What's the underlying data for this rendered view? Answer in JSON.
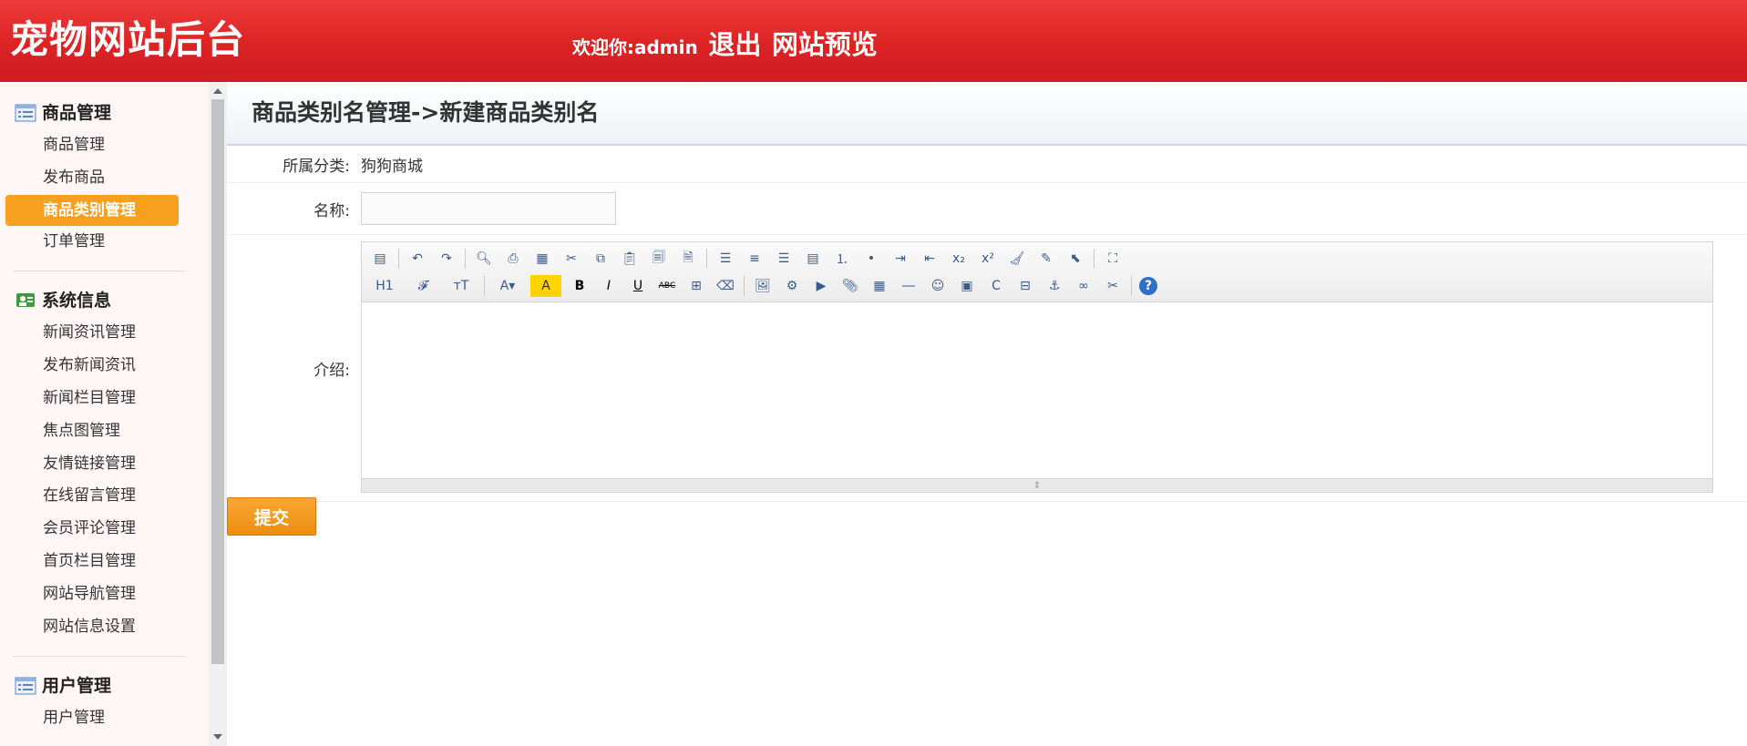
{
  "header": {
    "brand": "宠物网站后台",
    "welcome": "欢迎你:admin",
    "logout": "退出",
    "preview": "网站预览"
  },
  "sidebar": {
    "groups": [
      {
        "title": "商品管理",
        "icon": "list-icon",
        "items": [
          "商品管理",
          "发布商品",
          "商品类别管理",
          "订单管理"
        ],
        "active_index": 2
      },
      {
        "title": "系统信息",
        "icon": "users-icon",
        "items": [
          "新闻资讯管理",
          "发布新闻资讯",
          "新闻栏目管理",
          "焦点图管理",
          "友情链接管理",
          "在线留言管理",
          "会员评论管理",
          "首页栏目管理",
          "网站导航管理",
          "网站信息设置"
        ]
      },
      {
        "title": "用户管理",
        "icon": "list-icon",
        "items": [
          "用户管理"
        ]
      }
    ]
  },
  "main": {
    "title": "商品类别名管理->新建商品类别名",
    "form": {
      "category_label": "所属分类:",
      "category_value": "狗狗商城",
      "name_label": "名称:",
      "name_value": "",
      "intro_label": "介绍:",
      "submit": "提交"
    },
    "editor": {
      "font_size_label": "H1",
      "font_family_label": "𝓕",
      "line_height_label": "тT",
      "strike_label": "ABC"
    }
  },
  "colors": {
    "header": "#dc2324",
    "active": "#f79f1e",
    "sidebar_bg": "#fff7f5"
  }
}
